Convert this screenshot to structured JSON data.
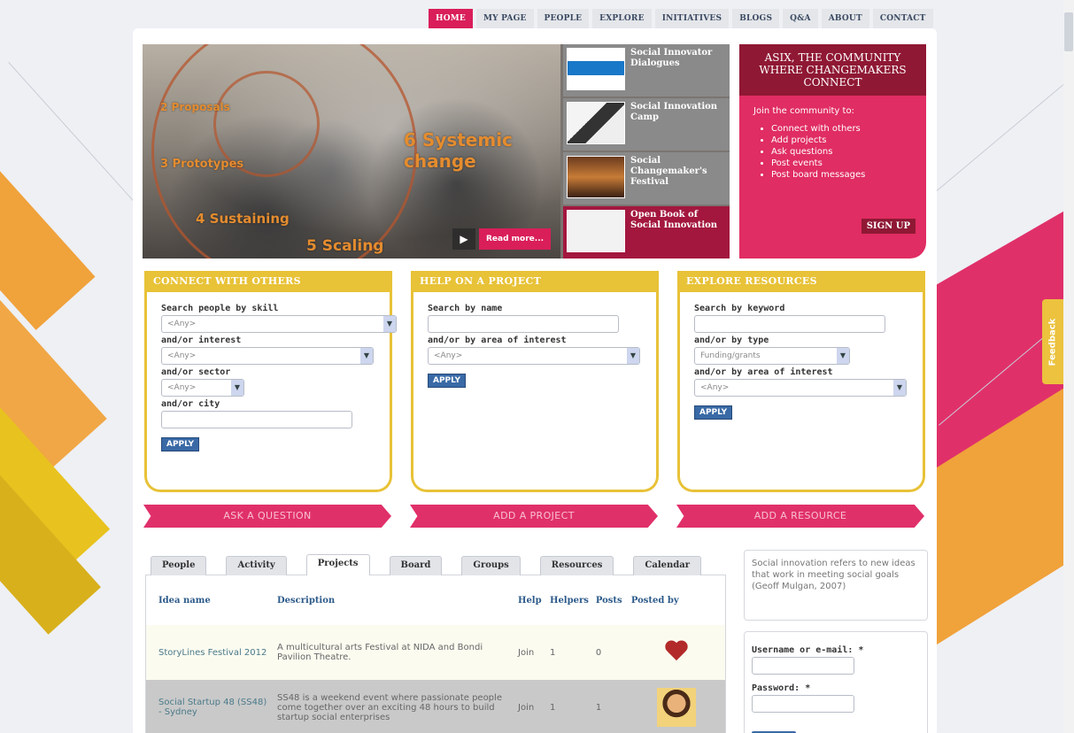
{
  "nav": {
    "items": [
      "HOME",
      "MY PAGE",
      "PEOPLE",
      "EXPLORE",
      "INITIATIVES",
      "BLOGS",
      "Q&A",
      "ABOUT",
      "CONTACT"
    ],
    "active": "HOME"
  },
  "hero": {
    "words": {
      "w1": "2 Proposals",
      "w2": "3 Prototypes",
      "w3": "4 Sustaining",
      "w4": "6 Systemic change",
      "w5": "5 Scaling"
    },
    "read_more": "Read more...",
    "list": [
      {
        "title": "Social Innovator Dialogues"
      },
      {
        "title": "Social Innovation Camp"
      },
      {
        "title": "Social Changemaker's Festival"
      },
      {
        "title": "Open Book of Social Innovation"
      }
    ]
  },
  "signup": {
    "heading": "ASIX, THE COMMUNITY WHERE CHANGEMAKERS CONNECT",
    "intro": "Join the community to:",
    "items": [
      "Connect with others",
      "Add projects",
      "Ask questions",
      "Post events",
      "Post board messages"
    ],
    "button": "SIGN UP"
  },
  "boxes": {
    "connect": {
      "title": "CONNECT WITH OTHERS",
      "skill_label": "Search people by skill",
      "skill_value": "<Any>",
      "interest_label": "and/or interest",
      "interest_value": "<Any>",
      "sector_label": "and/or sector",
      "sector_value": "<Any>",
      "city_label": "and/or city",
      "apply": "APPLY"
    },
    "help": {
      "title": "HELP ON A PROJECT",
      "name_label": "Search by name",
      "area_label": "and/or by area of interest",
      "area_value": "<Any>",
      "apply": "APPLY"
    },
    "explore": {
      "title": "EXPLORE RESOURCES",
      "keyword_label": "Search by keyword",
      "type_label": "and/or by type",
      "type_value": "Funding/grants",
      "area_label": "and/or by area of interest",
      "area_value": "<Any>",
      "apply": "APPLY"
    }
  },
  "actions": {
    "ask": "ASK A QUESTION",
    "add_project": "ADD A PROJECT",
    "add_resource": "ADD A RESOURCE"
  },
  "tabs": [
    "People",
    "Activity",
    "Projects",
    "Board",
    "Groups",
    "Resources",
    "Calendar"
  ],
  "active_tab": "Projects",
  "table": {
    "headers": [
      "Idea name",
      "Description",
      "Help",
      "Helpers",
      "Posts",
      "Posted by"
    ],
    "rows": [
      {
        "name": "StoryLines Festival 2012",
        "description": "A multicultural arts Festival at NIDA and Bondi Pavilion Theatre.",
        "help": "Join",
        "helpers": "1",
        "posts": "0"
      },
      {
        "name": "Social Startup 48 (SS48) - Sydney",
        "description": "SS48 is a weekend event where passionate people come together over an exciting 48 hours to build startup social enterprises",
        "help": "Join",
        "helpers": "1",
        "posts": "1"
      }
    ]
  },
  "quote": "Social innovation refers to new ideas that work in meeting social goals (Geoff Mulgan, 2007)",
  "login": {
    "username_label": "Username or e-mail: *",
    "password_label": "Password: *"
  },
  "feedback": "Feedback",
  "colors": {
    "brand_pink": "#e0306a",
    "brand_dark": "#8f1834",
    "accent_yellow": "#e8c237",
    "link_blue": "#2c5a8a"
  }
}
